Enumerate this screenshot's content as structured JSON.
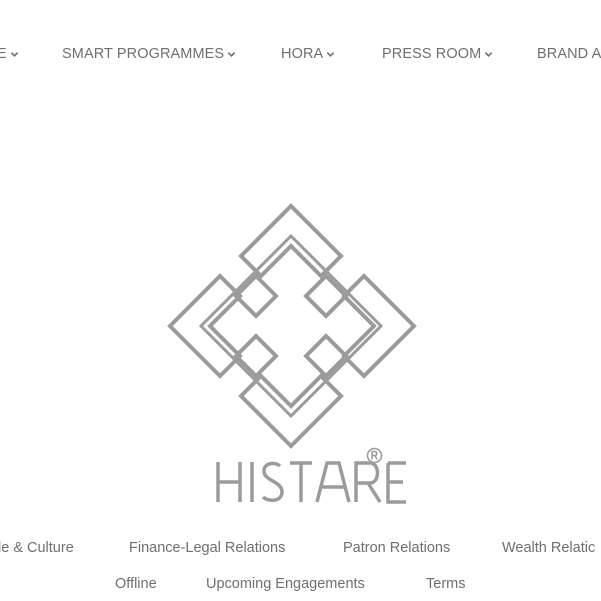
{
  "nav": {
    "items": [
      {
        "label": "E"
      },
      {
        "label": "SMART PROGRAMMES"
      },
      {
        "label": "HORA"
      },
      {
        "label": "PRESS ROOM"
      },
      {
        "label": "BRAND A"
      }
    ],
    "text_color": "#6f6f6f"
  },
  "logo": {
    "icon": "interlocking-diamond-knot-icon",
    "wordmark": "HISTARE",
    "registered": "®",
    "color": "#9b9b9b"
  },
  "footer": {
    "row1": [
      {
        "label": "le & Culture"
      },
      {
        "label": "Finance-Legal Relations"
      },
      {
        "label": "Patron Relations"
      },
      {
        "label": "Wealth Relatic"
      }
    ],
    "row2": [
      {
        "label": "Offline"
      },
      {
        "label": "Upcoming Engagements"
      },
      {
        "label": "Terms"
      }
    ]
  }
}
